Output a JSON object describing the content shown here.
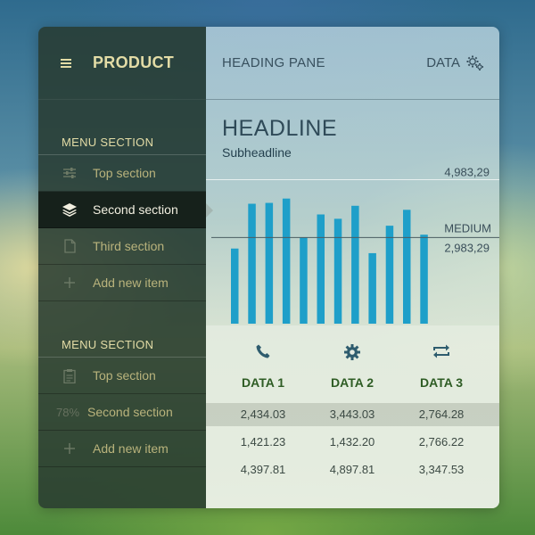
{
  "sidebar": {
    "brand": "PRODUCT",
    "sections": [
      {
        "label": "MENU SECTION",
        "items": [
          {
            "label": "Top section",
            "icon": "sliders-icon"
          },
          {
            "label": "Second section",
            "icon": "layers-icon",
            "active": true
          },
          {
            "label": "Third section",
            "icon": "document-icon"
          },
          {
            "label": "Add new item",
            "icon": "plus-icon"
          }
        ]
      },
      {
        "label": "MENU SECTION",
        "items": [
          {
            "label": "Top section",
            "icon": "clipboard-icon"
          },
          {
            "label": "Second section",
            "prefix": "78%"
          },
          {
            "label": "Add new item",
            "icon": "plus-icon"
          }
        ]
      }
    ]
  },
  "header": {
    "pane_title": "HEADING PANE",
    "data_label": "DATA"
  },
  "main": {
    "headline": "HEADLINE",
    "subheadline": "Subheadline"
  },
  "chart_data": {
    "type": "bar",
    "values": [
      2600,
      4150,
      4180,
      4330,
      2980,
      3780,
      3630,
      4080,
      2440,
      3390,
      3940,
      3080
    ],
    "reference_lines": [
      {
        "value": 4983.29,
        "label": "4,983,29"
      },
      {
        "value": 2983.29,
        "label": "2,983,29",
        "name": "MEDIUM"
      }
    ],
    "ylim": [
      0,
      5400
    ],
    "color": "#1e9fc9",
    "grid": false
  },
  "table": {
    "columns": [
      {
        "label": "DATA 1",
        "icon": "phone-icon"
      },
      {
        "label": "DATA 2",
        "icon": "gear-icon"
      },
      {
        "label": "DATA 3",
        "icon": "repeat-icon"
      }
    ],
    "rows": [
      [
        "2,434.03",
        "3,443.03",
        "2,764.28"
      ],
      [
        "1,421.23",
        "1,432.20",
        "2,766.22"
      ],
      [
        "4,397.81",
        "4,897.81",
        "3,347.53"
      ]
    ],
    "accent": "#2e5c24"
  }
}
